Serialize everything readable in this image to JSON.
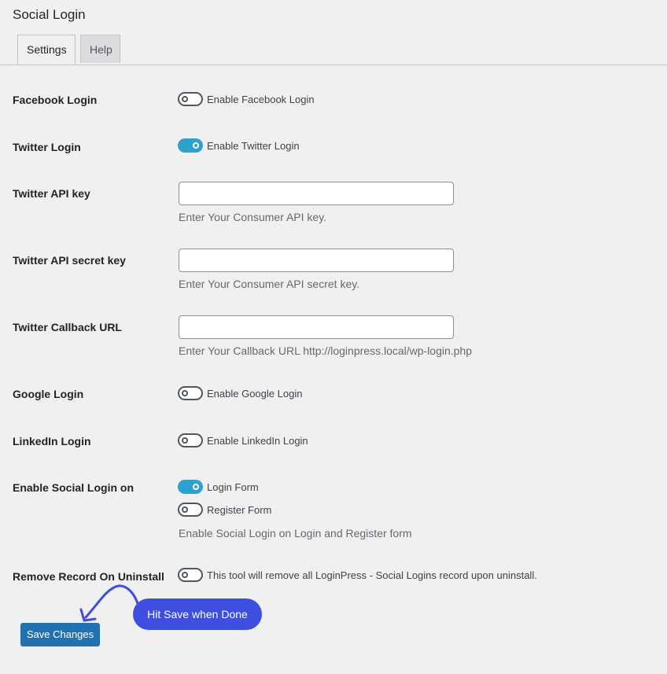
{
  "page": {
    "title": "Social Login"
  },
  "tabs": [
    {
      "label": "Settings",
      "active": true
    },
    {
      "label": "Help",
      "active": false
    }
  ],
  "settings": {
    "facebook": {
      "label": "Facebook Login",
      "toggle_text": "Enable Facebook Login",
      "enabled": false
    },
    "twitter": {
      "label": "Twitter Login",
      "toggle_text": "Enable Twitter Login",
      "enabled": true
    },
    "twitter_api_key": {
      "label": "Twitter API key",
      "value": "",
      "description": "Enter Your Consumer API key."
    },
    "twitter_api_secret": {
      "label": "Twitter API secret key",
      "value": "",
      "description": "Enter Your Consumer API secret key."
    },
    "twitter_callback": {
      "label": "Twitter Callback URL",
      "value": "",
      "description": "Enter Your Callback URL http://loginpress.local/wp-login.php"
    },
    "google": {
      "label": "Google Login",
      "toggle_text": "Enable Google Login",
      "enabled": false
    },
    "linkedin": {
      "label": "LinkedIn Login",
      "toggle_text": "Enable LinkedIn Login",
      "enabled": false
    },
    "enable_on": {
      "label": "Enable Social Login on",
      "login_form": {
        "toggle_text": "Login Form",
        "enabled": true
      },
      "register_form": {
        "toggle_text": "Register Form",
        "enabled": false
      },
      "description": "Enable Social Login on Login and Register form"
    },
    "remove_record": {
      "label": "Remove Record On Uninstall",
      "toggle_text": "This tool will remove all LoginPress - Social Logins record upon uninstall.",
      "enabled": false
    }
  },
  "save_button": {
    "label": "Save Changes"
  },
  "callout": {
    "text": "Hit Save when Done"
  },
  "colors": {
    "toggle_on": "#2ea2cc",
    "primary_button": "#2271b1",
    "callout": "#3e4fe0"
  }
}
